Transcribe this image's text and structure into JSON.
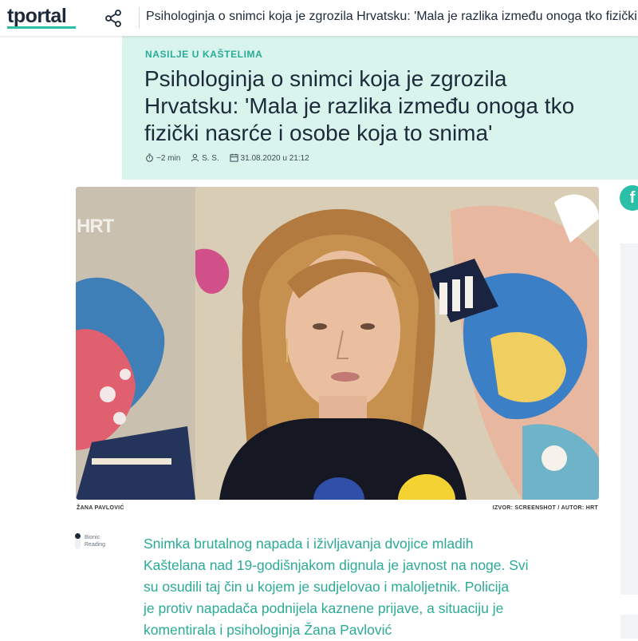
{
  "topbar": {
    "logo": "tportal",
    "share_icon": "share-icon",
    "title": "Psihologinja o snimci koja je zgrozila Hrvatsku: 'Mala je razlika između onoga tko fizički nasrće i osobe koja to snima'"
  },
  "article": {
    "kicker": "NASILJE U KAŠTELIMA",
    "headline_lines": [
      "Psihologinja o snimci koja je zgrozila",
      "Hrvatsku: 'Mala je razlika između onoga tko",
      "fizički nasrće i osobe koja to snima'"
    ],
    "meta": {
      "read_time": "~2 min",
      "author": "S. S.",
      "date": "31.08.2020 u 21:12"
    },
    "image": {
      "watermark": "HRT",
      "caption_left": "ŽANA PAVLOVIĆ",
      "caption_right": "IZVOR: SCREENSHOT / AUTOR: HRT"
    },
    "bionic_reading_label": "Bionic Reading",
    "lead_lines": [
      "Snimka brutalnog napada i iživljavanja dvojice mladih",
      "Kaštelana nad 19-godišnjakom dignula je javnost na noge. Svi",
      "su osudili taj čin u kojem je sudjelovao i maloljetnik. Policija",
      "je protiv napadača podnijela kaznene prijave, a situaciju je",
      "komentirala i psihologinja Žana Pavlović"
    ]
  },
  "social": {
    "facebook_label": "f"
  },
  "colors": {
    "accent": "#2bbfa7",
    "hero_bg": "#d9f4ec",
    "text_dark": "#1c2a3a",
    "lead_text": "#2bab96"
  }
}
